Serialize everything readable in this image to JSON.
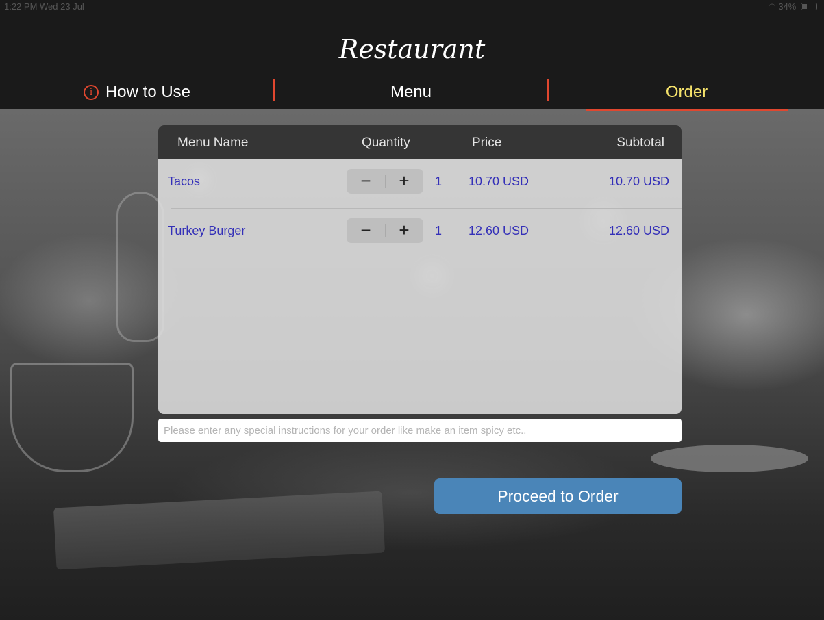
{
  "status_bar": {
    "time": "1:22 PM  Wed 23 Jul",
    "battery": "34%"
  },
  "header": {
    "brand": "Restaurant",
    "tabs": [
      {
        "label": "How to Use",
        "icon": "info-icon"
      },
      {
        "label": "Menu"
      },
      {
        "label": "Order",
        "active": true
      }
    ]
  },
  "order_table": {
    "columns": [
      "Menu Name",
      "Quantity",
      "Price",
      "Subtotal"
    ],
    "rows": [
      {
        "name": "Tacos",
        "minus": "−",
        "plus": "+",
        "quantity": "1",
        "price": "10.70 USD",
        "subtotal": "10.70 USD"
      },
      {
        "name": "Turkey Burger",
        "minus": "−",
        "plus": "+",
        "quantity": "1",
        "price": "12.60 USD",
        "subtotal": "12.60 USD"
      }
    ]
  },
  "instructions": {
    "placeholder": "Please enter any special instructions for your order like make an item spicy etc..",
    "value": ""
  },
  "proceed_label": "Proceed to Order",
  "colors": {
    "accent": "#e0472f",
    "active_tab": "#f5e26b",
    "item_text": "#3430b8",
    "button": "#4a85b8"
  }
}
